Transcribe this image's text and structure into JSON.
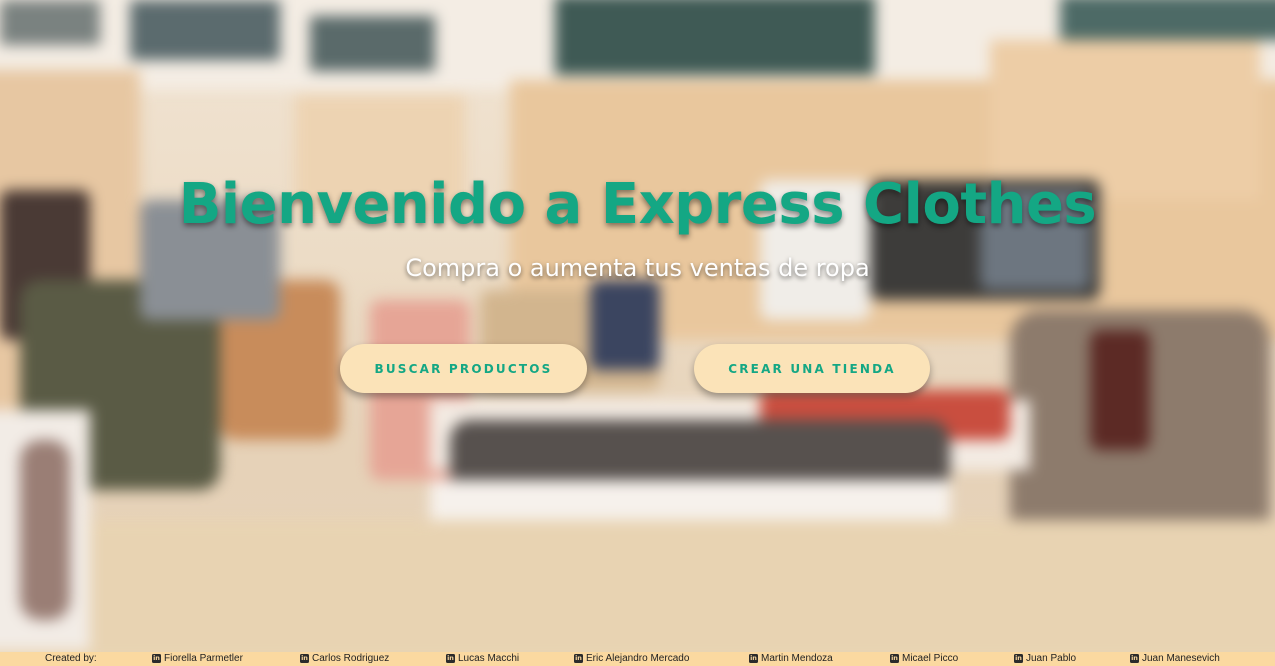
{
  "hero": {
    "title": "Bienvenido a Express Clothes",
    "subtitle": "Compra o aumenta tus ventas de ropa"
  },
  "actions": {
    "search_products": "BUSCAR PRODUCTOS",
    "create_store": "CREAR UNA TIENDA"
  },
  "footer": {
    "created_by": "Created by:",
    "credits": [
      {
        "name": "Fiorella Parmetler",
        "icon": "linkedin-icon"
      },
      {
        "name": "Carlos Rodriguez",
        "icon": "linkedin-icon"
      },
      {
        "name": "Lucas Macchi",
        "icon": "linkedin-icon"
      },
      {
        "name": "Eric Alejandro Mercado",
        "icon": "linkedin-icon"
      },
      {
        "name": "Martin Mendoza",
        "icon": "linkedin-icon"
      },
      {
        "name": "Micael Picco",
        "icon": "linkedin-icon"
      },
      {
        "name": "Juan Pablo",
        "icon": "linkedin-icon"
      },
      {
        "name": "Juan Manesevich",
        "icon": "linkedin-icon"
      }
    ]
  },
  "colors": {
    "accent": "#14a784",
    "button_bg": "#fbe3b8",
    "footer_bg": "#fbd9a0"
  }
}
